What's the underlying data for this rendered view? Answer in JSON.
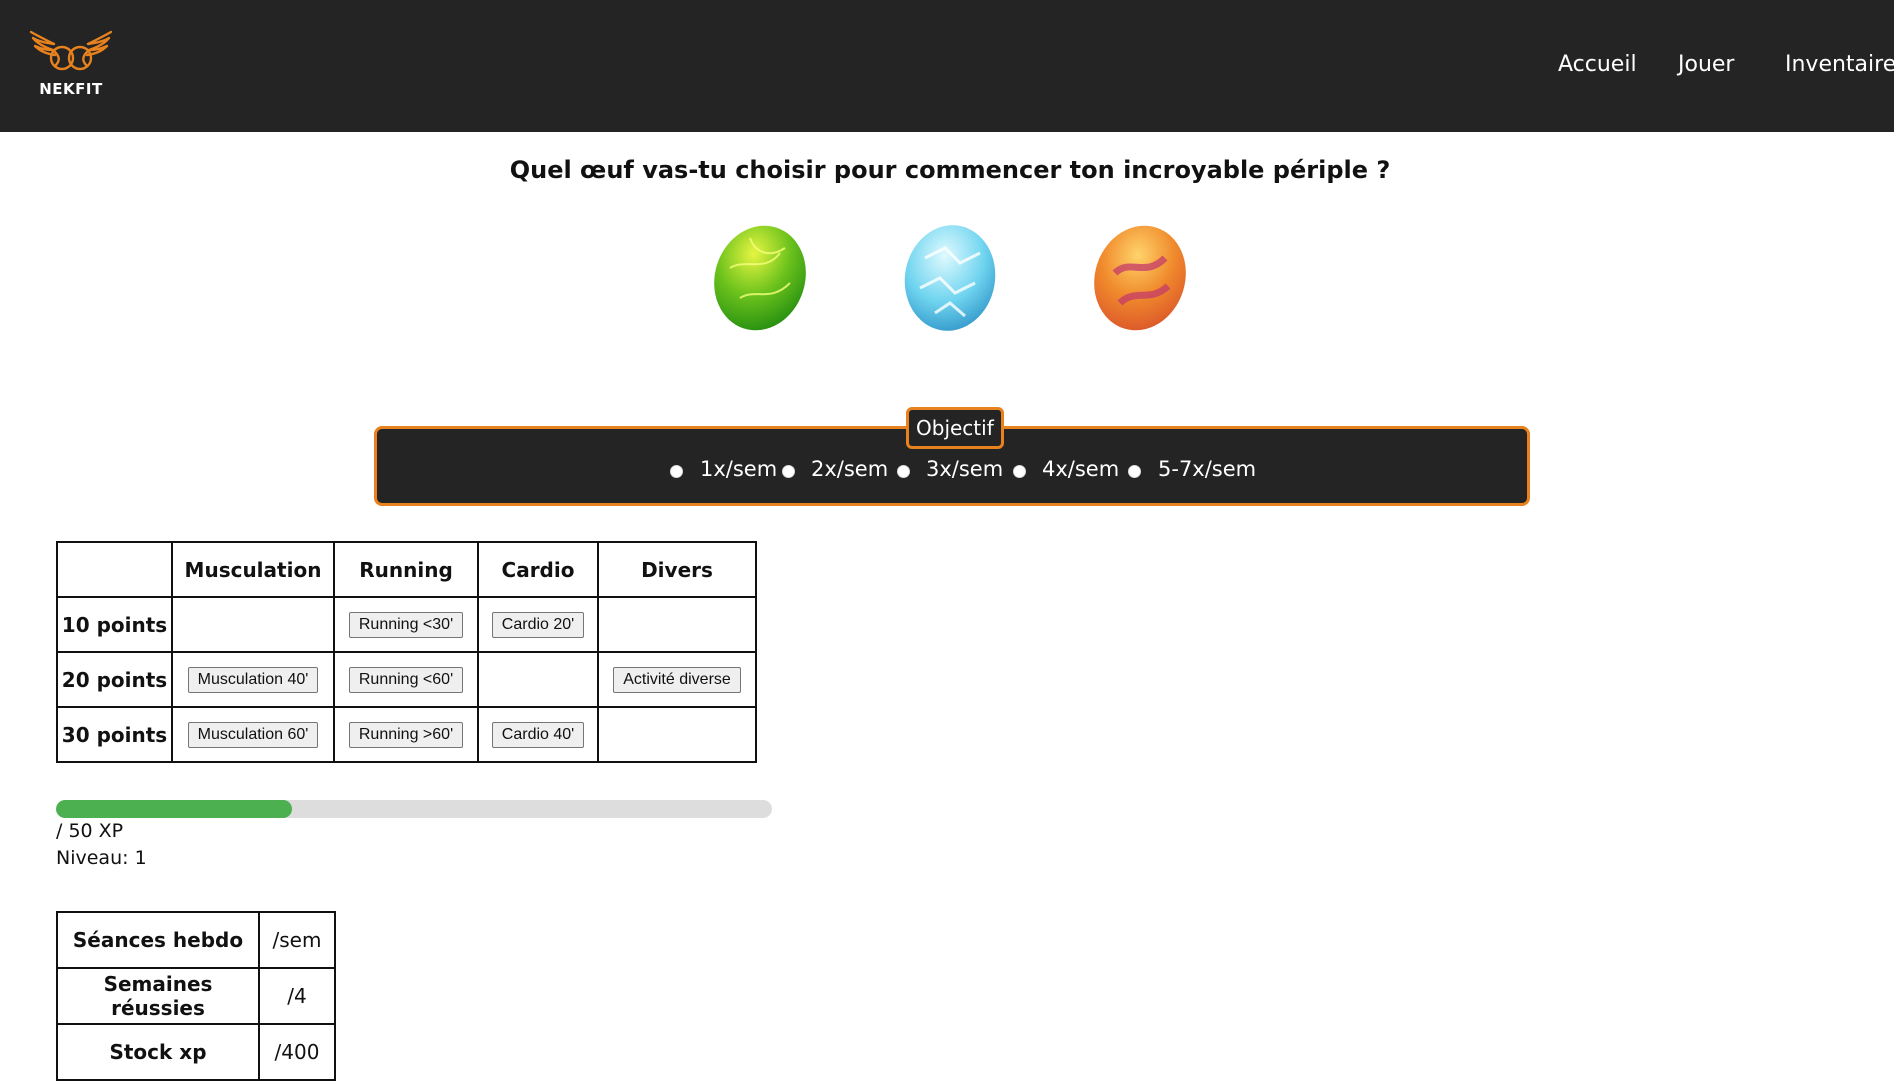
{
  "header": {
    "logo_text": "NEKFIT",
    "nav": [
      {
        "label": "Accueil"
      },
      {
        "label": "Jouer"
      },
      {
        "label": "Inventaire"
      }
    ]
  },
  "title": "Quel œuf vas-tu choisir pour commencer ton incroyable périple ?",
  "eggs": [
    {
      "name": "green-egg",
      "color": "#5fbf1f"
    },
    {
      "name": "ice-egg",
      "color": "#5ec9e8"
    },
    {
      "name": "fire-egg",
      "color": "#f07a2a"
    }
  ],
  "objectif": {
    "legend": "Objectif",
    "options": [
      "1x/sem",
      "2x/sem",
      "3x/sem",
      "4x/sem",
      "5-7x/sem"
    ]
  },
  "points_table": {
    "headers": [
      "",
      "Musculation",
      "Running",
      "Cardio",
      "Divers"
    ],
    "rows": [
      {
        "label": "10 points",
        "cells": [
          "",
          "Running <30'",
          "Cardio 20'",
          ""
        ]
      },
      {
        "label": "20 points",
        "cells": [
          "Musculation 40'",
          "Running <60'",
          "",
          "Activité diverse"
        ]
      },
      {
        "label": "30 points",
        "cells": [
          "Musculation 60'",
          "Running >60'",
          "Cardio 40'",
          ""
        ]
      }
    ]
  },
  "progress": {
    "fraction": 0.33,
    "xp_text": "/ 50 XP",
    "level_label": "Niveau: ",
    "level_value": "1"
  },
  "stats": [
    {
      "label": "Séances hebdo",
      "value": "/sem"
    },
    {
      "label": "Semaines réussies",
      "value": "/4"
    },
    {
      "label": "Stock xp",
      "value": "/400"
    }
  ],
  "colors": {
    "header_bg": "#242424",
    "accent": "#e8821e",
    "progress": "#4caf50"
  }
}
